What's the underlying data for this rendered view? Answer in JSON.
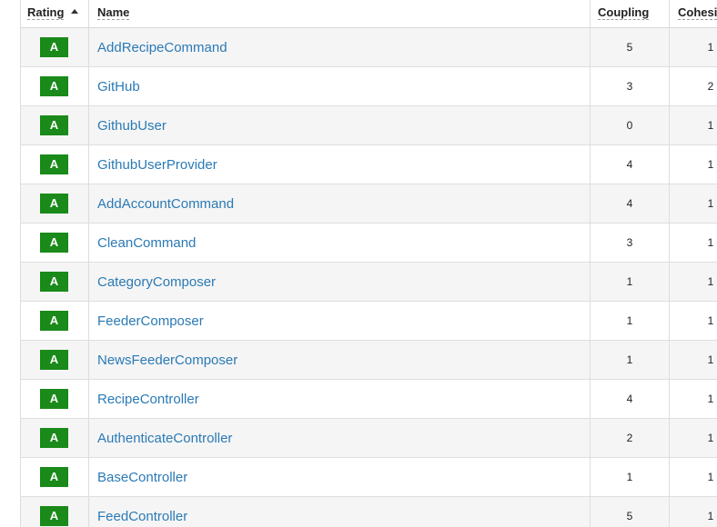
{
  "header": {
    "rating": "Rating",
    "name": "Name",
    "coupling": "Coupling",
    "cohesion": "Cohesi"
  },
  "colors": {
    "badge_green": "#1a8a1a",
    "link_blue": "#2a7ab5",
    "row_alt": "#f5f5f5"
  },
  "rows": [
    {
      "rating": "A",
      "name": "AddRecipeCommand",
      "coupling": "5",
      "cohesion": "1"
    },
    {
      "rating": "A",
      "name": "GitHub",
      "coupling": "3",
      "cohesion": "2"
    },
    {
      "rating": "A",
      "name": "GithubUser",
      "coupling": "0",
      "cohesion": "1"
    },
    {
      "rating": "A",
      "name": "GithubUserProvider",
      "coupling": "4",
      "cohesion": "1"
    },
    {
      "rating": "A",
      "name": "AddAccountCommand",
      "coupling": "4",
      "cohesion": "1"
    },
    {
      "rating": "A",
      "name": "CleanCommand",
      "coupling": "3",
      "cohesion": "1"
    },
    {
      "rating": "A",
      "name": "CategoryComposer",
      "coupling": "1",
      "cohesion": "1"
    },
    {
      "rating": "A",
      "name": "FeederComposer",
      "coupling": "1",
      "cohesion": "1"
    },
    {
      "rating": "A",
      "name": "NewsFeederComposer",
      "coupling": "1",
      "cohesion": "1"
    },
    {
      "rating": "A",
      "name": "RecipeController",
      "coupling": "4",
      "cohesion": "1"
    },
    {
      "rating": "A",
      "name": "AuthenticateController",
      "coupling": "2",
      "cohesion": "1"
    },
    {
      "rating": "A",
      "name": "BaseController",
      "coupling": "1",
      "cohesion": "1"
    },
    {
      "rating": "A",
      "name": "FeedController",
      "coupling": "5",
      "cohesion": "1"
    }
  ]
}
